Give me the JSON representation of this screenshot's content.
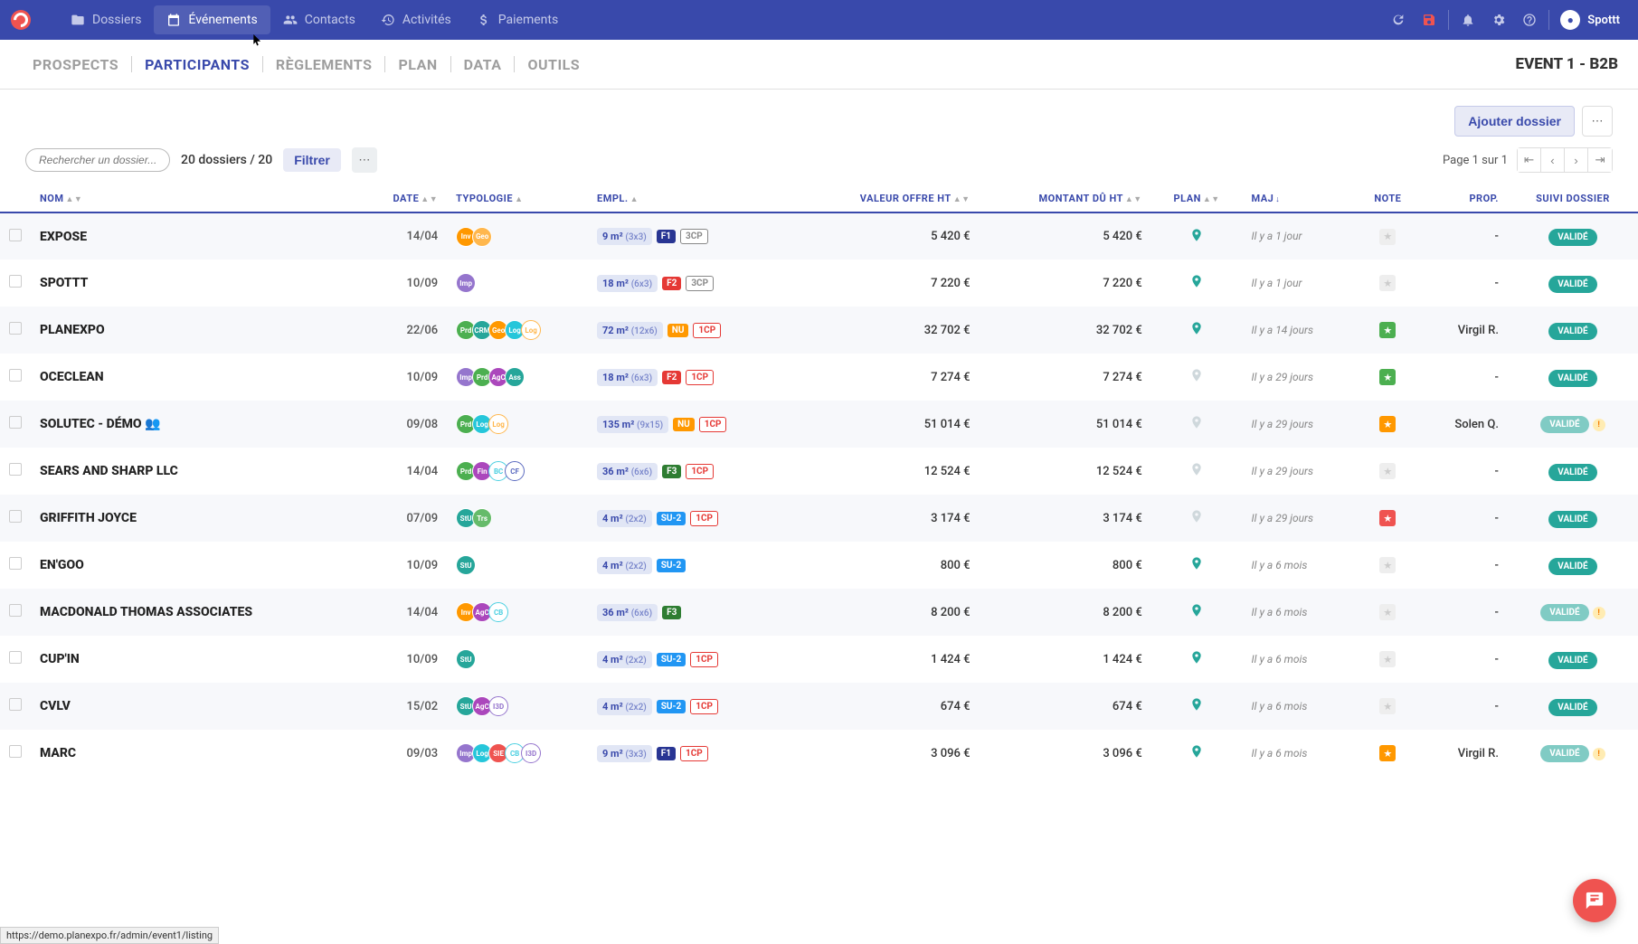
{
  "nav": {
    "items": [
      {
        "label": "Dossiers",
        "icon": "folder-icon"
      },
      {
        "label": "Événements",
        "icon": "calendar-icon",
        "active": true
      },
      {
        "label": "Contacts",
        "icon": "people-icon"
      },
      {
        "label": "Activités",
        "icon": "history-icon"
      },
      {
        "label": "Paiements",
        "icon": "money-icon"
      }
    ],
    "user": "Spottt"
  },
  "subtabs": {
    "items": [
      "PROSPECTS",
      "PARTICIPANTS",
      "RÈGLEMENTS",
      "PLAN",
      "DATA",
      "OUTILS"
    ],
    "active_index": 1,
    "event_title": "EVENT 1 - B2B"
  },
  "actions": {
    "add_folder": "Ajouter dossier"
  },
  "toolbar": {
    "search_placeholder": "Rechercher un dossier...",
    "count_text": "20 dossiers / 20",
    "filter_label": "Filtrer",
    "pager_text": "Page 1 sur 1"
  },
  "columns": {
    "nom": "NOM",
    "date": "DATE",
    "typologie": "TYPOLOGIE",
    "empl": "EMPL.",
    "valeur": "VALEUR OFFRE HT",
    "montant": "MONTANT DÛ HT",
    "plan": "PLAN",
    "maj": "MAJ",
    "note": "NOTE",
    "prop": "PROP.",
    "suivi": "SUIVI DOSSIER"
  },
  "rows": [
    {
      "name": "EXPOSE",
      "date": "14/04",
      "typo": [
        {
          "t": "Inv",
          "c": "#ff9800"
        },
        {
          "t": "Geo",
          "c": "#ffb74d"
        }
      ],
      "empl": {
        "area": "9 m²",
        "dim": "(3x3)",
        "tags": [
          {
            "t": "F1",
            "cls": "tag-f1"
          },
          {
            "t": "3CP",
            "cls": "tag-cp2"
          }
        ]
      },
      "valeur": "5 420 €",
      "montant": "5 420 €",
      "plan": "green",
      "maj": "Il y a 1 jour",
      "note": "grey",
      "prop": "-",
      "status": "VALIDÉ",
      "warn": false,
      "light": false
    },
    {
      "name": "SPOTTT",
      "date": "10/09",
      "typo": [
        {
          "t": "Imp",
          "c": "#9575cd"
        }
      ],
      "empl": {
        "area": "18 m²",
        "dim": "(6x3)",
        "tags": [
          {
            "t": "F2",
            "cls": "tag-f2"
          },
          {
            "t": "3CP",
            "cls": "tag-cp2"
          }
        ]
      },
      "valeur": "7 220 €",
      "montant": "7 220 €",
      "plan": "green",
      "maj": "Il y a 1 jour",
      "note": "grey",
      "prop": "-",
      "status": "VALIDÉ",
      "warn": false,
      "light": false
    },
    {
      "name": "PLANEXPO",
      "date": "22/06",
      "typo": [
        {
          "t": "Prd",
          "c": "#4caf50"
        },
        {
          "t": "CRM",
          "c": "#26a69a"
        },
        {
          "t": "Geo",
          "c": "#ff9800"
        },
        {
          "t": "Log",
          "c": "#26c6da"
        },
        {
          "t": "Log",
          "c": "#ffb74d",
          "outline": true
        }
      ],
      "empl": {
        "area": "72 m²",
        "dim": "(12x6)",
        "tags": [
          {
            "t": "NU",
            "cls": "tag-nu"
          },
          {
            "t": "1CP",
            "cls": "tag-cp"
          }
        ]
      },
      "valeur": "32 702 €",
      "montant": "32 702 €",
      "plan": "green",
      "maj": "Il y a 14 jours",
      "note": "green",
      "prop": "Virgil R.",
      "status": "VALIDÉ",
      "warn": false,
      "light": false
    },
    {
      "name": "OCECLEAN",
      "date": "10/09",
      "typo": [
        {
          "t": "Imp",
          "c": "#9575cd"
        },
        {
          "t": "Prd",
          "c": "#4caf50"
        },
        {
          "t": "AgC",
          "c": "#ab47bc"
        },
        {
          "t": "Ass",
          "c": "#26a69a"
        }
      ],
      "empl": {
        "area": "18 m²",
        "dim": "(6x3)",
        "tags": [
          {
            "t": "F2",
            "cls": "tag-f2"
          },
          {
            "t": "1CP",
            "cls": "tag-cp"
          }
        ]
      },
      "valeur": "7 274 €",
      "montant": "7 274 €",
      "plan": "grey",
      "maj": "Il y a 29 jours",
      "note": "green",
      "prop": "-",
      "status": "VALIDÉ",
      "warn": false,
      "light": false
    },
    {
      "name": "SOLUTEC - DÉMO 👥",
      "date": "09/08",
      "typo": [
        {
          "t": "Prd",
          "c": "#4caf50"
        },
        {
          "t": "Log",
          "c": "#26c6da"
        },
        {
          "t": "Log",
          "c": "#ffb74d",
          "outline": true
        }
      ],
      "empl": {
        "area": "135 m²",
        "dim": "(9x15)",
        "tags": [
          {
            "t": "NU",
            "cls": "tag-nu"
          },
          {
            "t": "1CP",
            "cls": "tag-cp"
          }
        ]
      },
      "valeur": "51 014 €",
      "montant": "51 014 €",
      "plan": "grey",
      "maj": "Il y a 29 jours",
      "note": "orange",
      "prop": "Solen Q.",
      "status": "VALIDÉ",
      "warn": true,
      "light": true
    },
    {
      "name": "SEARS AND SHARP LLC",
      "date": "14/04",
      "typo": [
        {
          "t": "Prd",
          "c": "#4caf50"
        },
        {
          "t": "Fin",
          "c": "#ab47bc"
        },
        {
          "t": "BC",
          "c": "#4dd0e1",
          "outline": true
        },
        {
          "t": "CF",
          "c": "#5c6bc0",
          "outline": true
        }
      ],
      "empl": {
        "area": "36 m²",
        "dim": "(6x6)",
        "tags": [
          {
            "t": "F3",
            "cls": "tag-f3"
          },
          {
            "t": "1CP",
            "cls": "tag-cp"
          }
        ]
      },
      "valeur": "12 524 €",
      "montant": "12 524 €",
      "plan": "grey",
      "maj": "Il y a 29 jours",
      "note": "grey",
      "prop": "-",
      "status": "VALIDÉ",
      "warn": false,
      "light": false
    },
    {
      "name": "GRIFFITH JOYCE",
      "date": "07/09",
      "typo": [
        {
          "t": "StU",
          "c": "#26a69a"
        },
        {
          "t": "Trs",
          "c": "#66bb6a"
        }
      ],
      "empl": {
        "area": "4 m²",
        "dim": "(2x2)",
        "tags": [
          {
            "t": "SU-2",
            "cls": "tag-su2"
          },
          {
            "t": "1CP",
            "cls": "tag-cp"
          }
        ]
      },
      "valeur": "3 174 €",
      "montant": "3 174 €",
      "plan": "grey",
      "maj": "Il y a 29 jours",
      "note": "red",
      "prop": "-",
      "status": "VALIDÉ",
      "warn": false,
      "light": false
    },
    {
      "name": "EN'GOO",
      "date": "10/09",
      "typo": [
        {
          "t": "StU",
          "c": "#26a69a"
        }
      ],
      "empl": {
        "area": "4 m²",
        "dim": "(2x2)",
        "tags": [
          {
            "t": "SU-2",
            "cls": "tag-su2"
          }
        ]
      },
      "valeur": "800 €",
      "montant": "800 €",
      "plan": "green",
      "maj": "Il y a 6 mois",
      "note": "grey",
      "prop": "-",
      "status": "VALIDÉ",
      "warn": false,
      "light": false
    },
    {
      "name": "MACDONALD THOMAS ASSOCIATES",
      "date": "14/04",
      "typo": [
        {
          "t": "Inv",
          "c": "#ff9800"
        },
        {
          "t": "AgC",
          "c": "#ab47bc"
        },
        {
          "t": "CB",
          "c": "#4dd0e1",
          "outline": true
        }
      ],
      "empl": {
        "area": "36 m²",
        "dim": "(6x6)",
        "tags": [
          {
            "t": "F3",
            "cls": "tag-f3"
          }
        ]
      },
      "valeur": "8 200 €",
      "montant": "8 200 €",
      "plan": "green",
      "maj": "Il y a 6 mois",
      "note": "grey",
      "prop": "-",
      "status": "VALIDÉ",
      "warn": true,
      "light": true
    },
    {
      "name": "CUP'IN",
      "date": "10/09",
      "typo": [
        {
          "t": "StU",
          "c": "#26a69a"
        }
      ],
      "empl": {
        "area": "4 m²",
        "dim": "(2x2)",
        "tags": [
          {
            "t": "SU-2",
            "cls": "tag-su2"
          },
          {
            "t": "1CP",
            "cls": "tag-cp"
          }
        ]
      },
      "valeur": "1 424 €",
      "montant": "1 424 €",
      "plan": "green",
      "maj": "Il y a 6 mois",
      "note": "grey",
      "prop": "-",
      "status": "VALIDÉ",
      "warn": false,
      "light": false
    },
    {
      "name": "CVLV",
      "date": "15/02",
      "typo": [
        {
          "t": "StU",
          "c": "#26a69a"
        },
        {
          "t": "AgC",
          "c": "#ab47bc"
        },
        {
          "t": "I3D",
          "c": "#9575cd",
          "outline": true
        }
      ],
      "empl": {
        "area": "4 m²",
        "dim": "(2x2)",
        "tags": [
          {
            "t": "SU-2",
            "cls": "tag-su2"
          },
          {
            "t": "1CP",
            "cls": "tag-cp"
          }
        ]
      },
      "valeur": "674 €",
      "montant": "674 €",
      "plan": "green",
      "maj": "Il y a 6 mois",
      "note": "grey",
      "prop": "-",
      "status": "VALIDÉ",
      "warn": false,
      "light": false
    },
    {
      "name": "MARC",
      "date": "09/03",
      "typo": [
        {
          "t": "Imp",
          "c": "#9575cd"
        },
        {
          "t": "Log",
          "c": "#26c6da"
        },
        {
          "t": "SIE",
          "c": "#ef5350"
        },
        {
          "t": "CB",
          "c": "#4dd0e1",
          "outline": true
        },
        {
          "t": "I3D",
          "c": "#9575cd",
          "outline": true
        }
      ],
      "empl": {
        "area": "9 m²",
        "dim": "(3x3)",
        "tags": [
          {
            "t": "F1",
            "cls": "tag-f1"
          },
          {
            "t": "1CP",
            "cls": "tag-cp"
          }
        ]
      },
      "valeur": "3 096 €",
      "montant": "3 096 €",
      "plan": "green",
      "maj": "Il y a 6 mois",
      "note": "orange",
      "prop": "Virgil R.",
      "status": "VALIDÉ",
      "warn": true,
      "light": true
    }
  ],
  "status_url": "https://demo.planexpo.fr/admin/event1/listing"
}
